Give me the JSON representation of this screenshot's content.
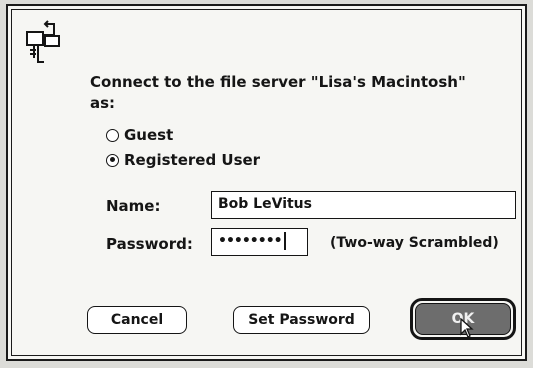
{
  "dialog": {
    "prompt_line1": "Connect to the file server \"Lisa's Macintosh\"",
    "prompt_line2": "as:",
    "icon": "file-server-icon"
  },
  "login_options": [
    {
      "label": "Guest",
      "selected": false
    },
    {
      "label": "Registered User",
      "selected": true
    }
  ],
  "fields": {
    "name_label": "Name:",
    "name_value": "Bob LeVitus",
    "password_label": "Password:",
    "password_value": "••••••••",
    "password_note": "(Two-way Scrambled)"
  },
  "buttons": {
    "cancel": "Cancel",
    "set_password": "Set Password",
    "ok": "OK"
  }
}
